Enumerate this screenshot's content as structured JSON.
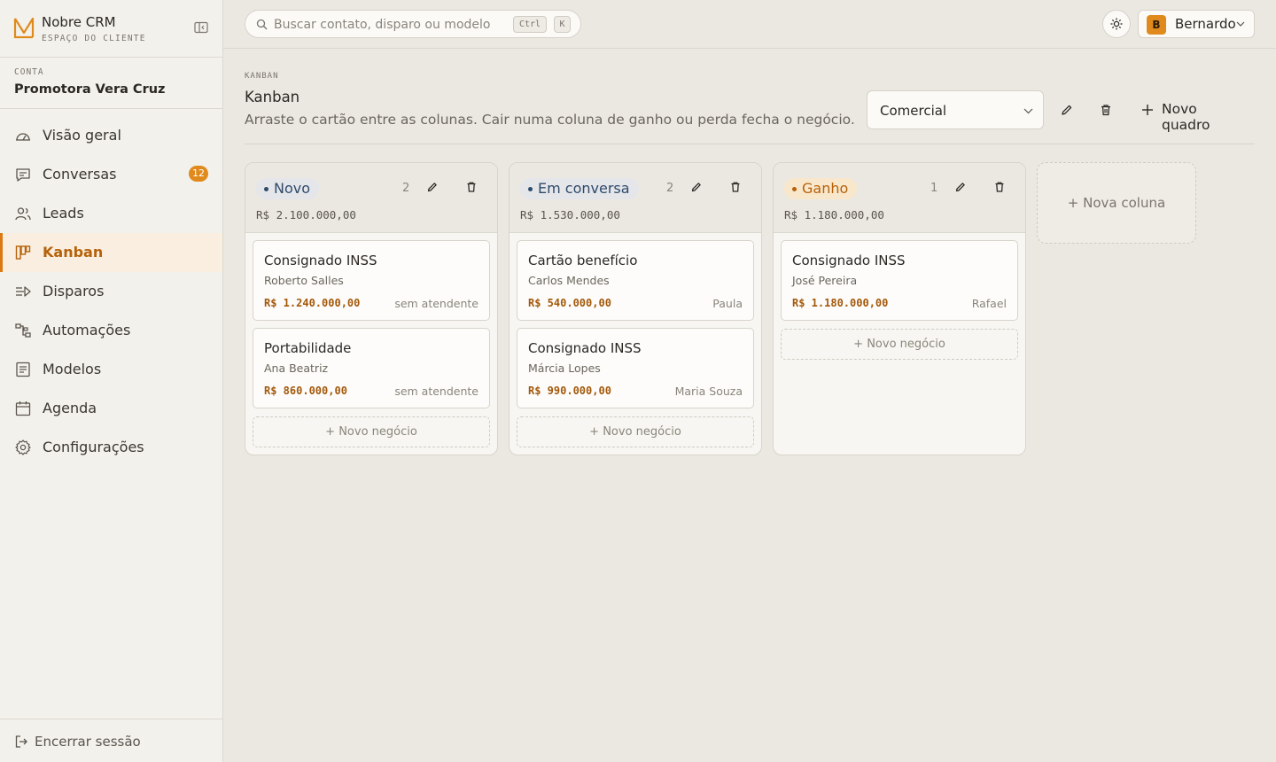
{
  "brand": {
    "name": "Nobre CRM",
    "subtitle": "ESPAÇO DO CLIENTE"
  },
  "account": {
    "label": "CONTA",
    "name": "Promotora Vera Cruz"
  },
  "nav": [
    {
      "label": "Visão geral",
      "icon": "gauge-icon"
    },
    {
      "label": "Conversas",
      "icon": "chat-icon",
      "badge": "12"
    },
    {
      "label": "Leads",
      "icon": "users-icon"
    },
    {
      "label": "Kanban",
      "icon": "kanban-icon",
      "active": true
    },
    {
      "label": "Disparos",
      "icon": "send-icon"
    },
    {
      "label": "Automações",
      "icon": "workflow-icon"
    },
    {
      "label": "Modelos",
      "icon": "template-icon"
    },
    {
      "label": "Agenda",
      "icon": "calendar-icon"
    },
    {
      "label": "Configurações",
      "icon": "settings-icon"
    }
  ],
  "logout": {
    "label": "Encerrar sessão"
  },
  "search": {
    "placeholder": "Buscar contato, disparo ou modelo",
    "shortcut_key1": "Ctrl",
    "shortcut_key2": "K"
  },
  "user": {
    "initial": "B",
    "name": "Bernardo"
  },
  "page": {
    "eyebrow": "KANBAN",
    "title": "Kanban",
    "description": "Arraste o cartão entre as colunas. Cair numa coluna de ganho ou perda fecha o negócio.",
    "board_select": "Comercial",
    "new_board_label": "Novo quadro"
  },
  "columns": [
    {
      "name": "Novo",
      "count": "2",
      "total": "R$ 2.100.000,00",
      "color": "#2f4a6a",
      "cards": [
        {
          "title": "Consignado INSS",
          "contact": "Roberto Salles",
          "value": "R$ 1.240.000,00",
          "owner": "sem atendente"
        },
        {
          "title": "Portabilidade",
          "contact": "Ana Beatriz",
          "value": "R$ 860.000,00",
          "owner": "sem atendente"
        }
      ],
      "add_label": "Novo negócio"
    },
    {
      "name": "Em conversa",
      "count": "2",
      "total": "R$ 1.530.000,00",
      "color": "#2f4a6a",
      "cards": [
        {
          "title": "Cartão benefício",
          "contact": "Carlos Mendes",
          "value": "R$ 540.000,00",
          "owner": "Paula"
        },
        {
          "title": "Consignado INSS",
          "contact": "Márcia Lopes",
          "value": "R$ 990.000,00",
          "owner": "Maria Souza"
        }
      ],
      "add_label": "Novo negócio"
    },
    {
      "name": "Ganho",
      "count": "1",
      "total": "R$ 1.180.000,00",
      "color": "#e08a1e",
      "cards": [
        {
          "title": "Consignado INSS",
          "contact": "José Pereira",
          "value": "R$ 1.180.000,00",
          "owner": "Rafael"
        }
      ],
      "add_label": "Novo negócio"
    }
  ],
  "new_column_label": "Nova coluna",
  "colors": {
    "accent": "#e08a1e",
    "accent_dark": "#b5620a",
    "background": "#ebe8e2",
    "sidebar": "#f3f1ec"
  }
}
